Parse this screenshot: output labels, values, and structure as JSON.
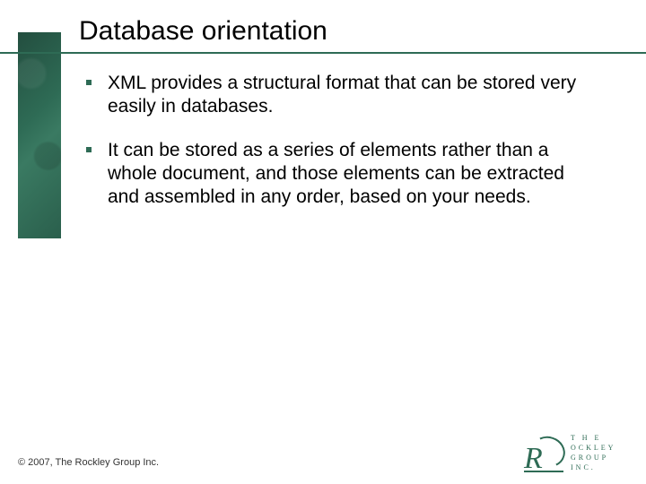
{
  "title": "Database orientation",
  "bullets": [
    "XML provides a structural format that can be stored very easily in databases.",
    "It can be stored as a series of elements rather than a whole document, and those elements can be extracted and assembled in any order, based on your needs."
  ],
  "footer": "© 2007, The Rockley Group Inc.",
  "logo": {
    "line1": "T H E",
    "line2": "ockley",
    "line3": "Group Inc."
  },
  "colors": {
    "accent": "#2e6b55"
  }
}
